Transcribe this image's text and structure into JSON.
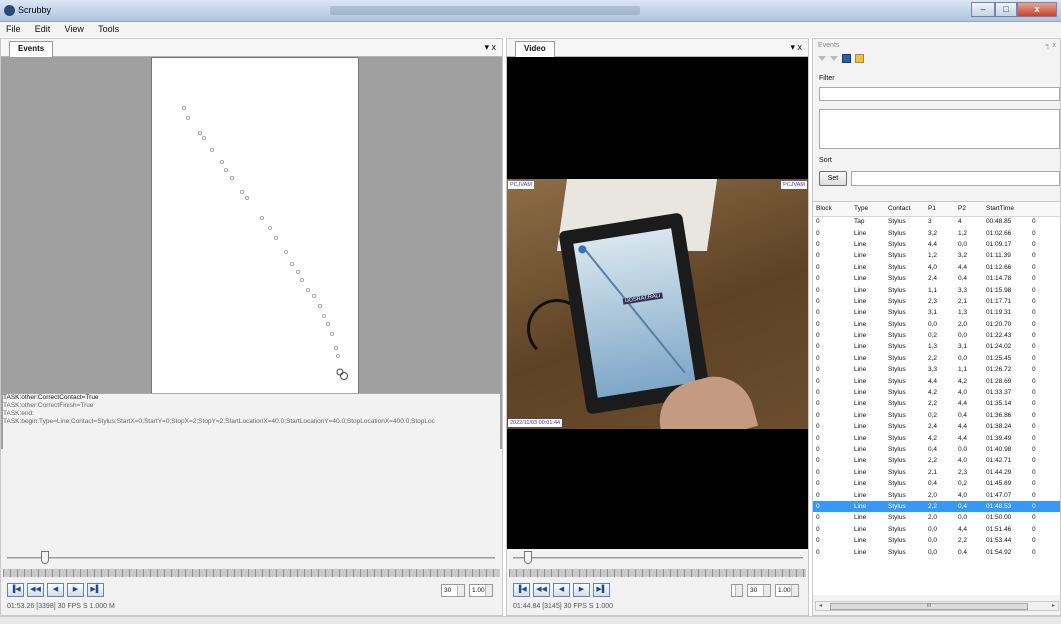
{
  "app": {
    "title": "Scrubby",
    "menus": [
      "File",
      "Edit",
      "View",
      "Tools"
    ],
    "window_buttons": {
      "minimize": "–",
      "maximize": "□",
      "close": "x"
    }
  },
  "events_panel": {
    "tab": "Events",
    "controls": "▾ x",
    "log_lines": [
      "TASK:other:CorrectContact=True",
      "TASK:other:CorrectFinish=True",
      "TASK:end:",
      "TASK:begin:Type=Line;Contact=Stylus;StartX=0;StartY=0;StopX=2;StopY=2;StartLocationX=40.0;StartLocationY=40.0;StopLocationX=400.0;StopLoc"
    ],
    "fps": "30",
    "speed": "1.00",
    "status": "01:53.26 [3398] 30 FPS S 1.000 M",
    "slider_fraction": 0.07
  },
  "video_panel": {
    "tab": "Video",
    "controls": "▾ x",
    "overlay_top_left": "PCJVAM",
    "overlay_top_right": "PCJVAM",
    "overlay_screen": "UOSRAT:RALI",
    "overlay_bottom": "2022/11/03 00:01:44",
    "fps": "30",
    "speed": "1.00",
    "status": "01:44.84 [3145] 30 FPS S 1.000",
    "slider_fraction": 0.04
  },
  "right_panel": {
    "header": "Events",
    "pin": "╕ x",
    "filter_label": "Filter",
    "sort_label": "Sort",
    "set_button": "Set",
    "scroll_left": "◂",
    "scroll_right": "▸",
    "scroll_grip": "III",
    "columns": [
      "Block",
      "Type",
      "Contact",
      "P1",
      "P2",
      "StartTime",
      ""
    ],
    "rows": [
      [
        "0",
        "Tap",
        "Stylus",
        "3",
        "4",
        "00:48.85",
        "0"
      ],
      [
        "0",
        "Line",
        "Stylus",
        "3,2",
        "1,2",
        "01:02.66",
        "0"
      ],
      [
        "0",
        "Line",
        "Stylus",
        "4,4",
        "0,0",
        "01:09.17",
        "0"
      ],
      [
        "0",
        "Line",
        "Stylus",
        "1,2",
        "3,2",
        "01:11.39",
        "0"
      ],
      [
        "0",
        "Line",
        "Stylus",
        "4,0",
        "4,4",
        "01:12.66",
        "0"
      ],
      [
        "0",
        "Line",
        "Stylus",
        "2,4",
        "0,4",
        "01:14.78",
        "0"
      ],
      [
        "0",
        "Line",
        "Stylus",
        "1,1",
        "3,3",
        "01:15.98",
        "0"
      ],
      [
        "0",
        "Line",
        "Stylus",
        "2,3",
        "2,1",
        "01:17.71",
        "0"
      ],
      [
        "0",
        "Line",
        "Stylus",
        "3,1",
        "1,3",
        "01:19.31",
        "0"
      ],
      [
        "0",
        "Line",
        "Stylus",
        "0,0",
        "2,0",
        "01:20.70",
        "0"
      ],
      [
        "0",
        "Line",
        "Stylus",
        "0,2",
        "0,0",
        "01:22.43",
        "0"
      ],
      [
        "0",
        "Line",
        "Stylus",
        "1,3",
        "3,1",
        "01:24.02",
        "0"
      ],
      [
        "0",
        "Line",
        "Stylus",
        "2,2",
        "0,0",
        "01:25.45",
        "0"
      ],
      [
        "0",
        "Line",
        "Stylus",
        "3,3",
        "1,1",
        "01:26.72",
        "0"
      ],
      [
        "0",
        "Line",
        "Stylus",
        "4,4",
        "4,2",
        "01:28.69",
        "0"
      ],
      [
        "0",
        "Line",
        "Stylus",
        "4,2",
        "4,0",
        "01:33.37",
        "0"
      ],
      [
        "0",
        "Line",
        "Stylus",
        "2,2",
        "4,4",
        "01:35.14",
        "0"
      ],
      [
        "0",
        "Line",
        "Stylus",
        "0,2",
        "0,4",
        "01:36.86",
        "0"
      ],
      [
        "0",
        "Line",
        "Stylus",
        "2,4",
        "4,4",
        "01:38.24",
        "0"
      ],
      [
        "0",
        "Line",
        "Stylus",
        "4,2",
        "4,4",
        "01:39.49",
        "0"
      ],
      [
        "0",
        "Line",
        "Stylus",
        "0,4",
        "0,0",
        "01:40.98",
        "0"
      ],
      [
        "0",
        "Line",
        "Stylus",
        "2,2",
        "4,0",
        "01:42.71",
        "0"
      ],
      [
        "0",
        "Line",
        "Stylus",
        "2,1",
        "2,3",
        "01:44.29",
        "0"
      ],
      [
        "0",
        "Line",
        "Stylus",
        "0,4",
        "0,2",
        "01:45.69",
        "0"
      ],
      [
        "0",
        "Line",
        "Stylus",
        "2,0",
        "4,0",
        "01:47.07",
        "0"
      ],
      [
        "0",
        "Line",
        "Stylus",
        "2,2",
        "0,4",
        "01:48.53",
        "0"
      ],
      [
        "0",
        "Line",
        "Stylus",
        "2,0",
        "0,0",
        "01:50.00",
        "0"
      ],
      [
        "0",
        "Line",
        "Stylus",
        "0,0",
        "4,4",
        "01:51.46",
        "0"
      ],
      [
        "0",
        "Line",
        "Stylus",
        "0,0",
        "2,2",
        "01:53.44",
        "0"
      ],
      [
        "0",
        "Line",
        "Stylus",
        "0,0",
        "0,4",
        "01:54.92",
        "0"
      ]
    ],
    "selected_row": 25
  },
  "colors": {
    "selection": "#3399ff",
    "workspace": "#a0a0a0",
    "video_bg": "#000000"
  }
}
